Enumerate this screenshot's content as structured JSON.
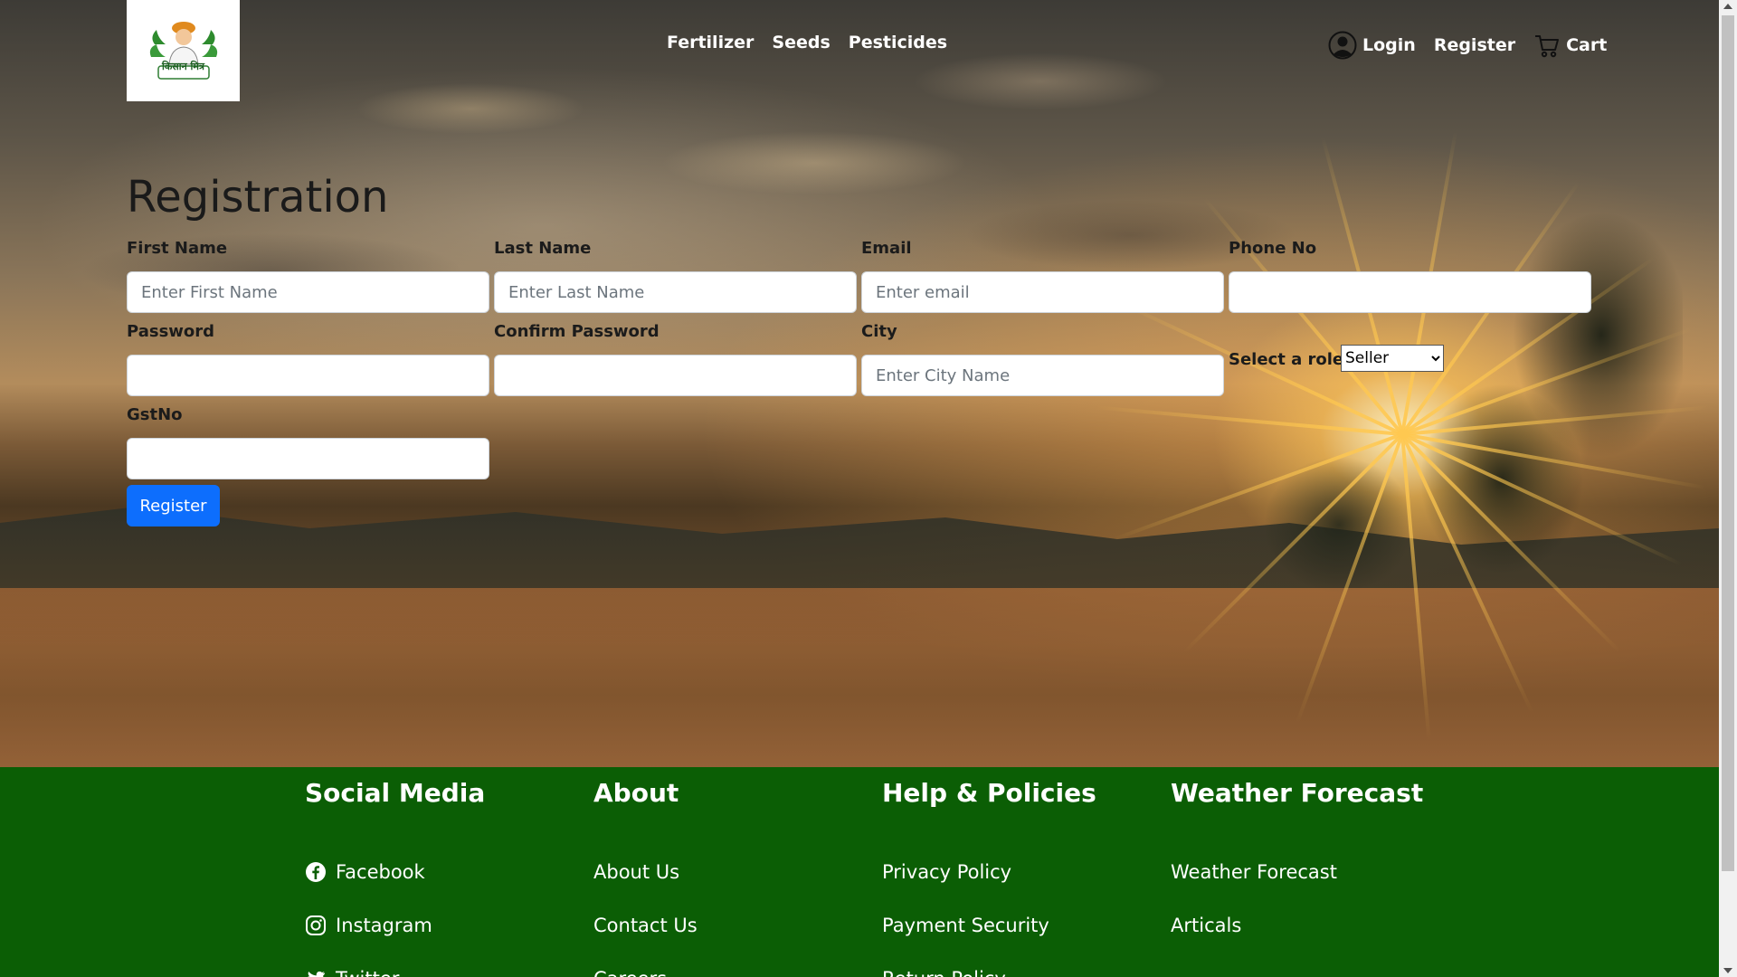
{
  "brand": {
    "logo_text": "किसान मित्र"
  },
  "nav": {
    "links": [
      {
        "label": "Fertilizer"
      },
      {
        "label": "Seeds"
      },
      {
        "label": "Pesticides"
      }
    ],
    "login_label": "Login",
    "register_label": "Register",
    "cart_label": "Cart"
  },
  "form": {
    "title": "Registration",
    "fields": {
      "first_name": {
        "label": "First Name",
        "placeholder": "Enter First Name",
        "value": ""
      },
      "last_name": {
        "label": "Last Name",
        "placeholder": "Enter Last Name",
        "value": ""
      },
      "email": {
        "label": "Email",
        "placeholder": "Enter email",
        "value": ""
      },
      "phone": {
        "label": "Phone No",
        "placeholder": "",
        "value": ""
      },
      "password": {
        "label": "Password",
        "placeholder": "",
        "value": ""
      },
      "confirm_password": {
        "label": "Confirm Password",
        "placeholder": "",
        "value": ""
      },
      "city": {
        "label": "City",
        "placeholder": "Enter City Name",
        "value": ""
      },
      "gst": {
        "label": "GstNo",
        "placeholder": "",
        "value": ""
      }
    },
    "role": {
      "label": "Select a role",
      "selected": "Seller"
    },
    "submit_label": "Register"
  },
  "footer": {
    "columns": [
      {
        "heading": "Social Media",
        "links": [
          {
            "label": "Facebook",
            "icon": "facebook-icon"
          },
          {
            "label": "Instagram",
            "icon": "instagram-icon"
          },
          {
            "label": "Twitter",
            "icon": "twitter-icon"
          }
        ]
      },
      {
        "heading": "About",
        "links": [
          {
            "label": "About Us"
          },
          {
            "label": "Contact Us"
          },
          {
            "label": "Careers"
          }
        ]
      },
      {
        "heading": "Help & Policies",
        "links": [
          {
            "label": "Privacy Policy"
          },
          {
            "label": "Payment Security"
          },
          {
            "label": "Return Policy"
          }
        ]
      },
      {
        "heading": "Weather Forecast",
        "links": [
          {
            "label": "Weather Forecast"
          },
          {
            "label": "Articals"
          }
        ]
      }
    ]
  },
  "colors": {
    "footer_bg": "#0b5e05",
    "primary_button": "#0d6efd",
    "nav_text": "#ffffff"
  }
}
